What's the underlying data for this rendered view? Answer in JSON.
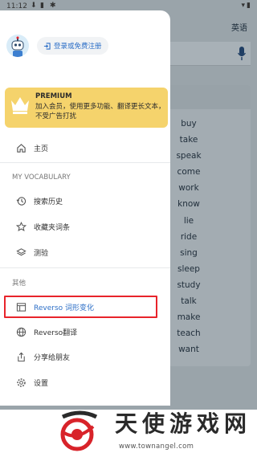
{
  "status_bar": {
    "time": "11:12",
    "icons": [
      "download-icon",
      "sim-icon",
      "bug-icon",
      "wifi-icon",
      "battery-icon"
    ]
  },
  "background": {
    "language_label": "英语",
    "words": [
      "buy",
      "take",
      "speak",
      "come",
      "work",
      "know",
      "lie",
      "ride",
      "sing",
      "sleep",
      "study",
      "talk",
      "make",
      "teach",
      "want"
    ]
  },
  "drawer": {
    "login_label": "登录或免费注册",
    "premium": {
      "title": "PREMIUM",
      "text": "加入会员，使用更多功能、翻译更长文本，不受广告打扰"
    },
    "home_label": "主页",
    "my_vocab_section": "MY VOCABULARY",
    "vocab_items": [
      {
        "label": "搜索历史",
        "icon": "history-icon"
      },
      {
        "label": "收藏夹词条",
        "icon": "star-icon"
      },
      {
        "label": "测验",
        "icon": "quiz-icon"
      }
    ],
    "other_section": "其他",
    "other_items": [
      {
        "label": "Reverso 词形变化",
        "icon": "table-icon",
        "highlighted": true
      },
      {
        "label": "Reverso翻译",
        "icon": "globe-icon"
      },
      {
        "label": "分享给朋友",
        "icon": "share-icon"
      },
      {
        "label": "设置",
        "icon": "gear-icon"
      }
    ]
  },
  "watermark": {
    "name_chars": [
      "天",
      "使",
      "游",
      "戏",
      "网"
    ],
    "url": "www.townangel.com"
  },
  "colors": {
    "premium_bg": "#f5d36c",
    "highlight_border": "#e8242b",
    "link_blue": "#2d6fc7",
    "overlay": "#9aa4aa"
  }
}
